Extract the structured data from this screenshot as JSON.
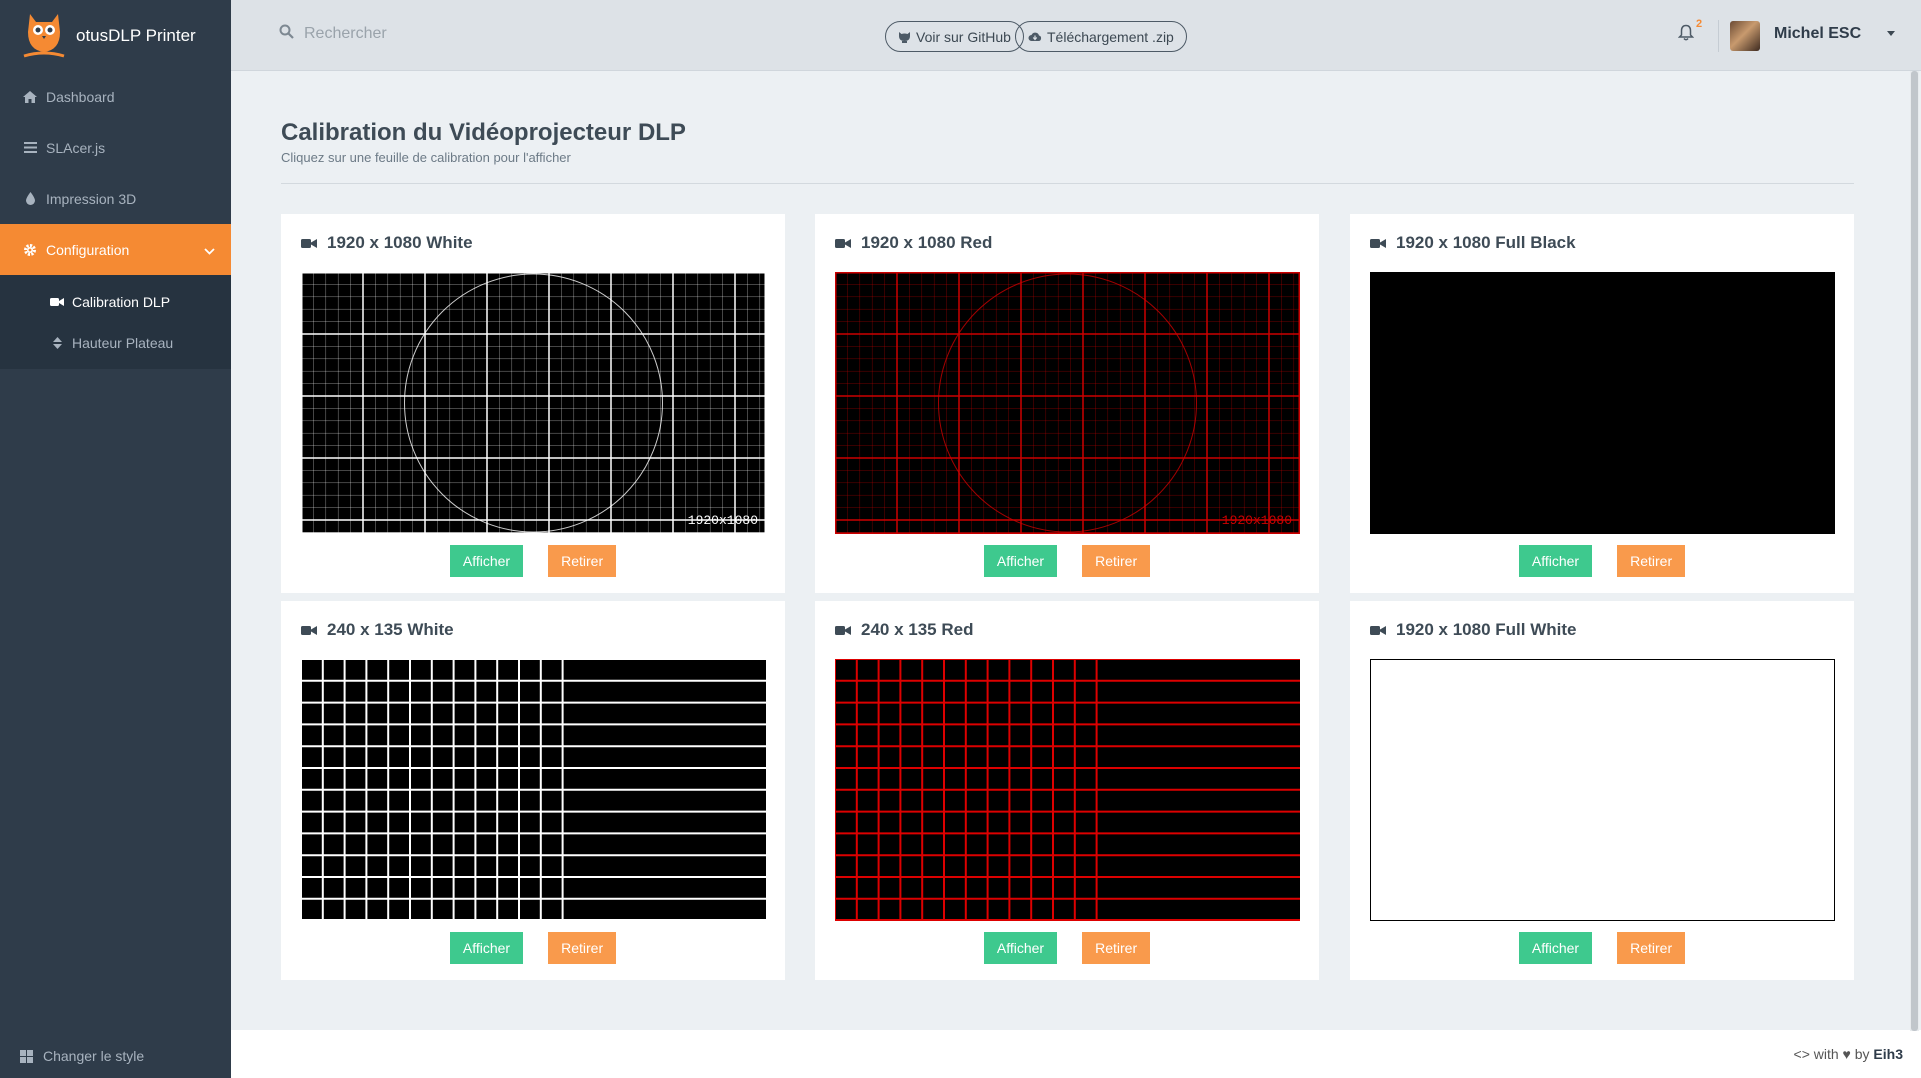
{
  "app": {
    "title": "otusDLP Printer"
  },
  "sidebar": {
    "items": [
      {
        "label": "Dashboard",
        "icon": "home-icon"
      },
      {
        "label": "SLAcer.js",
        "icon": "bars-icon"
      },
      {
        "label": "Impression 3D",
        "icon": "drop-icon"
      },
      {
        "label": "Configuration",
        "icon": "gear-icon"
      }
    ],
    "subitems": [
      {
        "label": "Calibration DLP",
        "icon": "video-icon"
      },
      {
        "label": "Hauteur Plateau",
        "icon": "sort-icon"
      }
    ],
    "footer_label": "Changer le style"
  },
  "topbar": {
    "search_placeholder": "Rechercher",
    "github_label": "Voir sur GitHub",
    "download_label": "Téléchargement .zip",
    "notification_count": "2",
    "user_name": "Michel ESC"
  },
  "page": {
    "title": "Calibration du Vidéoprojecteur DLP",
    "subtitle": "Cliquez sur une feuille de calibration pour l'afficher"
  },
  "cards": [
    {
      "title": "1920 x 1080 White",
      "pattern": "grid",
      "color": "#ffffff",
      "label": "1920x1080"
    },
    {
      "title": "1920 x 1080 Red",
      "pattern": "grid",
      "color": "#cc0000",
      "label": "1920x1080"
    },
    {
      "title": "1920 x 1080 Full Black",
      "pattern": "solid",
      "color": "#000000"
    },
    {
      "title": "240 x 135 White",
      "pattern": "coarse",
      "color": "#ffffff"
    },
    {
      "title": "240 x 135 Red",
      "pattern": "coarse",
      "color": "#dd0000"
    },
    {
      "title": "1920 x 1080 Full White",
      "pattern": "solid",
      "color": "#ffffff"
    }
  ],
  "buttons": {
    "show": "Afficher",
    "remove": "Retirer"
  },
  "footer": {
    "prefix": "<> with ♥ by",
    "author": "Eih3"
  },
  "colors": {
    "accent": "#f58a33",
    "sidebar": "#2f3c4a",
    "green": "#3ec98e",
    "orange": "#f99a4c"
  }
}
